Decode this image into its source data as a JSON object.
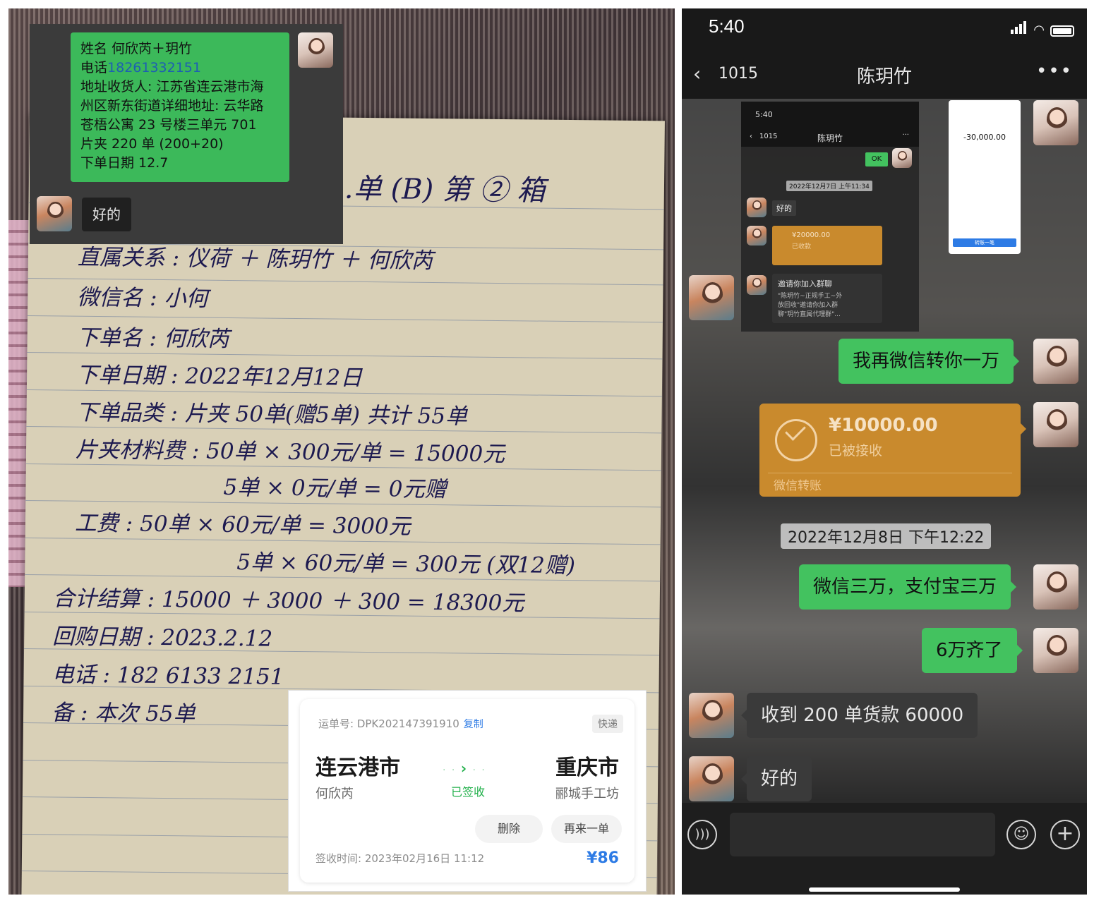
{
  "photo_chat": {
    "name_line": "姓名      何欣芮＋玥竹",
    "phone_label": "电话",
    "phone_number": "18261332151",
    "address_line1": "地址收货人: 江苏省连云港市海",
    "address_line2": "州区新东街道详细地址: 云华路",
    "address_line3": "苍梧公寓 23 号楼三单元 701",
    "order_count": "片夹 220 单 (200+20)",
    "order_date": "下单日期 12.7",
    "reply": "好的"
  },
  "notebook": {
    "title": "…单 (B) 第 ② 箱",
    "line1": "直属关系 : 仪荷 ＋ 陈玥竹 ＋ 何欣芮",
    "line2": "微信名 : 小何",
    "line3": "下单名 : 何欣芮",
    "line4": "下单日期 : 2022年12月12日",
    "line5": "下单品类 : 片夹 50单(赠5单) 共计 55单",
    "line6": "片夹材料费 : 50单 × 300元/单 = 15000元",
    "line7": "5单 × 0元/单 = 0元赠",
    "line8": "工费 : 50单 × 60元/单 = 3000元",
    "line9": "5单 × 60元/单 = 300元 (双12赠)",
    "line10": "合计结算 : 15000 ＋ 3000 ＋ 300 = 18300元",
    "line11": "回购日期 : 2023.2.12",
    "line12": "电话 : 182 6133 2151",
    "line13": "备 : 本次 55单"
  },
  "express": {
    "waybill_label": "运单号: DPK202147391910",
    "copy_label": "复制",
    "tag": "快递",
    "from_city": "连云港市",
    "from_person": "何欣芮",
    "status": "已签收",
    "to_city": "重庆市",
    "to_person": "郦城手工坊",
    "delete_btn": "删除",
    "reorder_btn": "再来一单",
    "signed_time": "签收时间: 2023年02月16日 11:12",
    "price": "¥86"
  },
  "phone": {
    "status_time": "5:40",
    "nav_back_count": "1015",
    "nav_title": "陈玥竹",
    "mini": {
      "time": "5:40",
      "count": "1015",
      "title": "陈玥竹",
      "ok": "OK",
      "date": "2022年12月7日 上午11:34",
      "reply": "好的",
      "amount": "¥20000.00",
      "amount_status": "已收款",
      "invite_title": "邀请你加入群聊",
      "invite_body1": "\"陈玥竹~正规手工~外",
      "invite_body2": "放回收\"邀请你加入群",
      "invite_body3": "聊\"玥竹直属代理群\"...",
      "receipt_amount": "-30,000.00",
      "receipt_btn": "转账一笔"
    },
    "messages": {
      "m1": "我再微信转你一万",
      "transfer_amount": "¥10000.00",
      "transfer_status": "已被接收",
      "transfer_foot": "微信转账",
      "timestamp": "2022年12月8日 下午12:22",
      "m2": "微信三万，支付宝三万",
      "m3": "6万齐了",
      "m4": "收到 200 单货款 60000",
      "m5": "好的"
    }
  }
}
